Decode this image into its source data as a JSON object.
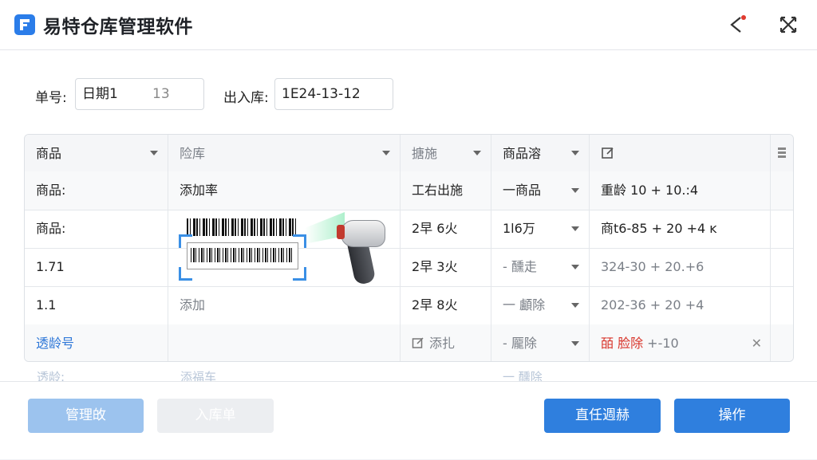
{
  "window": {
    "title": "易特仓库管理软件"
  },
  "titlebar": {
    "pin_icon": "pin-icon",
    "close_icon": "close-icon"
  },
  "form": {
    "order_no_label": "单号:",
    "order_no_value": "日期1",
    "order_no_suffix": "13",
    "in_out_label": "出入库:",
    "in_out_value": "1E24-13-12"
  },
  "table": {
    "headers": [
      "商品",
      "险库",
      "搪施",
      "商品溶",
      ""
    ],
    "rows": [
      {
        "c1": "商品:",
        "c2": "添加率",
        "c3": "工右出施",
        "c4": "一商品",
        "c5": "重龄 10 + 10.:4"
      },
      {
        "c1": "商品:",
        "c2": "",
        "c3": "2早 6火",
        "c4": "1l6万",
        "c5": "商t6-85 + 20 +4  ĸ"
      },
      {
        "c1": "1.71",
        "c2": "",
        "c3": "2早 3火",
        "c4": "- 醺走",
        "c5": "324-30 + 20.+6"
      },
      {
        "c1": "1.1",
        "c2": "添加",
        "c3": "2早 8火",
        "c4": "一 顱除",
        "c5": "202-36 + 20 +4"
      },
      {
        "c1": "透龄号",
        "c2": "",
        "c3": "添扎",
        "c4": "- 龎除",
        "c5_red": "皕 脸除",
        "c5_rest": " +-10"
      }
    ],
    "ghost_row": [
      "透龄:",
      "添福车",
      "",
      "一 醺除"
    ]
  },
  "footer": {
    "btn1": "管理敀",
    "btn2": "入库单",
    "btn3": "直任週赫",
    "btn4": "操作"
  },
  "colors": {
    "accent": "#2f7fde",
    "danger": "#d8342a",
    "link": "#2f78d8"
  }
}
